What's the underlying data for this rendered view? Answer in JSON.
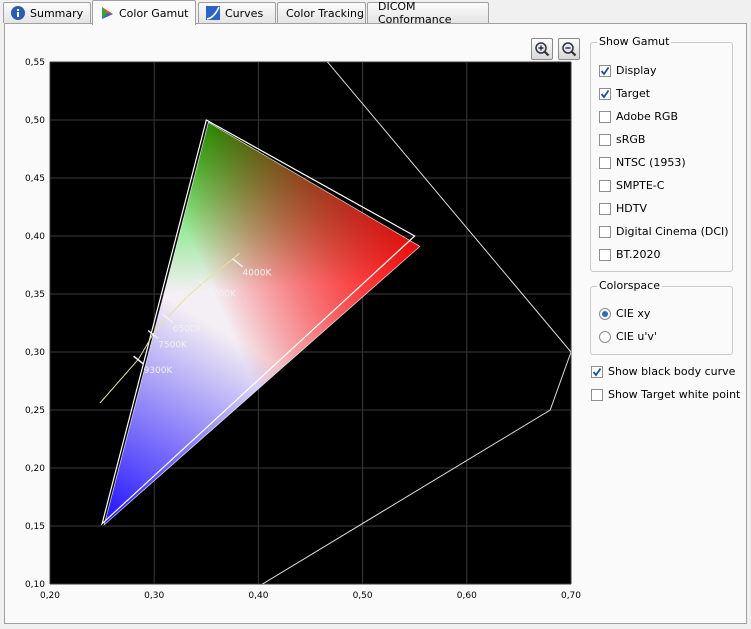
{
  "tabs": [
    {
      "label": "Summary",
      "icon": "info-icon",
      "active": false
    },
    {
      "label": "Color Gamut",
      "icon": "color-gamut-icon",
      "active": true
    },
    {
      "label": "Curves",
      "icon": "curves-icon",
      "active": false
    },
    {
      "label": "Color Tracking",
      "icon": "",
      "active": false
    },
    {
      "label": "DICOM Conformance",
      "icon": "",
      "active": false
    }
  ],
  "zoom": {
    "in_icon": "zoom-in-icon",
    "out_icon": "zoom-out-icon"
  },
  "show_gamut": {
    "title": "Show Gamut",
    "items": [
      {
        "label": "Display",
        "checked": true
      },
      {
        "label": "Target",
        "checked": true
      },
      {
        "label": "Adobe RGB",
        "checked": false
      },
      {
        "label": "sRGB",
        "checked": false
      },
      {
        "label": "NTSC (1953)",
        "checked": false
      },
      {
        "label": "SMPTE-C",
        "checked": false
      },
      {
        "label": "HDTV",
        "checked": false
      },
      {
        "label": "Digital Cinema (DCI)",
        "checked": false
      },
      {
        "label": "BT.2020",
        "checked": false
      }
    ]
  },
  "colorspace": {
    "title": "Colorspace",
    "options": [
      {
        "label": "CIE xy",
        "selected": true
      },
      {
        "label": "CIE u'v'",
        "selected": false
      }
    ]
  },
  "options": [
    {
      "label": "Show black body curve",
      "checked": true
    },
    {
      "label": "Show Target white point",
      "checked": false
    }
  ],
  "chart_data": {
    "type": "scatter",
    "xlim": [
      0.2,
      0.7
    ],
    "ylim": [
      0.1,
      0.55
    ],
    "x_ticks": [
      "0,20",
      "0,30",
      "0,40",
      "0,50",
      "0,60",
      "0,70"
    ],
    "y_ticks": [
      "0,55",
      "0,50",
      "0,45",
      "0,40",
      "0,35",
      "0,30",
      "0,25",
      "0,20",
      "0,15",
      "0,10"
    ],
    "x_tick_values": [
      0.2,
      0.3,
      0.4,
      0.5,
      0.6,
      0.7
    ],
    "y_tick_values": [
      0.55,
      0.5,
      0.45,
      0.4,
      0.35,
      0.3,
      0.25,
      0.2,
      0.15,
      0.1
    ],
    "grid": true,
    "display_gamut": [
      [
        0.555,
        0.391
      ],
      [
        0.352,
        0.498
      ],
      [
        0.252,
        0.151
      ]
    ],
    "target_gamut": [
      [
        0.55,
        0.4
      ],
      [
        0.35,
        0.5
      ],
      [
        0.25,
        0.152
      ]
    ],
    "spectral_locus": [
      [
        0.457,
        0.56
      ],
      [
        0.7,
        0.3
      ],
      [
        0.68,
        0.25
      ],
      [
        0.38,
        0.087
      ]
    ],
    "black_body_curve": [
      [
        0.382,
        0.385
      ],
      [
        0.346,
        0.359
      ],
      [
        0.331,
        0.347
      ],
      [
        0.312,
        0.329
      ],
      [
        0.3,
        0.317
      ],
      [
        0.285,
        0.294
      ],
      [
        0.248,
        0.256
      ]
    ],
    "cct_markers": [
      {
        "label": "4000K",
        "x": 0.38,
        "y": 0.377
      },
      {
        "label": "5000K",
        "x": 0.346,
        "y": 0.359
      },
      {
        "label": "5500K",
        "x": 0.332,
        "y": 0.347
      },
      {
        "label": "6500K",
        "x": 0.313,
        "y": 0.329
      },
      {
        "label": "7500K",
        "x": 0.299,
        "y": 0.315
      },
      {
        "label": "9300K",
        "x": 0.285,
        "y": 0.293
      }
    ]
  }
}
